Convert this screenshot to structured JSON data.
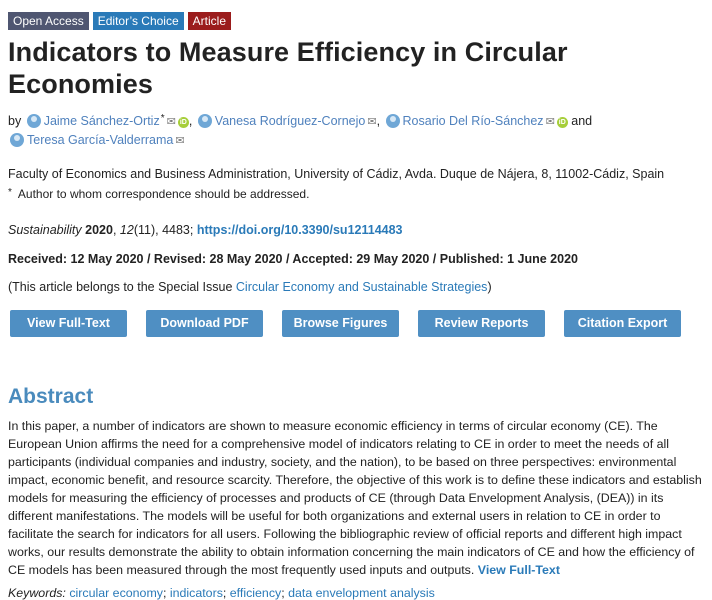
{
  "badges": {
    "open_access": "Open Access",
    "editors_choice": "Editor’s Choice",
    "article": "Article"
  },
  "title": "Indicators to Measure Efficiency in Circular Economies",
  "byline": {
    "by": "by",
    "authors": [
      "Jaime Sánchez-Ortiz",
      "Vanesa Rodríguez-Cornejo",
      "Rosario Del Río-Sánchez",
      "Teresa García-Valderrama"
    ],
    "corresponding_mark": "*",
    "and": "and",
    "orcid_label": "iD"
  },
  "affiliation": "Faculty of Economics and Business Administration, University of Cádiz, Avda. Duque de Nájera, 8, 11002-Cádiz, Spain",
  "correspondence": {
    "mark": "*",
    "text": "Author to whom correspondence should be addressed."
  },
  "citation": {
    "journal": "Sustainability",
    "year": "2020",
    "volume": "12",
    "issue": "(11)",
    "article_no": "4483;",
    "doi": "https://doi.org/10.3390/su12114483"
  },
  "dates": "Received: 12 May 2020 / Revised: 28 May 2020 / Accepted: 29 May 2020 / Published: 1 June 2020",
  "special_issue": {
    "prefix": "(This article belongs to the Special Issue ",
    "link": "Circular Economy and Sustainable Strategies",
    "suffix": ")"
  },
  "buttons": {
    "full_text": "View Full-Text",
    "pdf": "Download PDF",
    "figures": "Browse Figures",
    "reports": "Review Reports",
    "citation": "Citation Export"
  },
  "abstract": {
    "heading": "Abstract",
    "text": "In this paper, a number of indicators are shown to measure economic efficiency in terms of circular economy (CE). The European Union affirms the need for a comprehensive model of indicators relating to CE in order to meet the needs of all participants (individual companies and industry, society, and the nation), to be based on three perspectives: environmental impact, economic benefit, and resource scarcity. Therefore, the objective of this work is to define these indicators and establish models for measuring the efficiency of processes and products of CE (through Data Envelopment Analysis, (DEA)) in its different manifestations. The models will be useful for both organizations and external users in relation to CE in order to facilitate the search for indicators for all users. Following the bibliographic review of official reports and different high impact works, our results demonstrate the ability to obtain information concerning the main indicators of CE and how the efficiency of CE models has been measured through the most frequently used inputs and outputs.",
    "full_text_link": "View Full-Text"
  },
  "keywords": {
    "label": "Keywords:",
    "items": [
      "circular economy",
      "indicators",
      "efficiency",
      "data envelopment analysis"
    ]
  }
}
